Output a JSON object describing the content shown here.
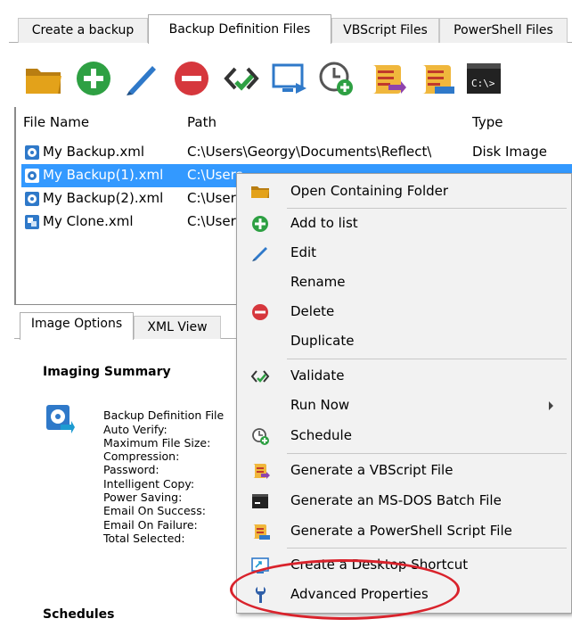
{
  "tabs": [
    {
      "label": "Create a backup",
      "active": false
    },
    {
      "label": "Backup Definition Files",
      "active": true
    },
    {
      "label": "VBScript Files",
      "active": false
    },
    {
      "label": "PowerShell Files",
      "active": false
    }
  ],
  "toolbar": {
    "buttons": [
      {
        "name": "open-folder",
        "icon": "folder-icon"
      },
      {
        "name": "add",
        "icon": "plus-circle-icon"
      },
      {
        "name": "edit",
        "icon": "pencil-icon"
      },
      {
        "name": "delete",
        "icon": "minus-circle-icon"
      },
      {
        "name": "validate",
        "icon": "validate-icon"
      },
      {
        "name": "run-now",
        "icon": "monitor-run-icon"
      },
      {
        "name": "schedule",
        "icon": "clock-add-icon"
      },
      {
        "name": "vbscript",
        "icon": "script-icon"
      },
      {
        "name": "powershell",
        "icon": "powershell-script-icon"
      },
      {
        "name": "msdos",
        "icon": "cmd-icon"
      }
    ],
    "cmd_label": "C:\\>"
  },
  "file_list": {
    "headers": {
      "name": "File Name",
      "path": "Path",
      "type": "Type"
    },
    "rows": [
      {
        "name": "My Backup.xml",
        "path": "C:\\Users\\Georgy\\Documents\\Reflect\\",
        "type": "Disk Image",
        "state": "normal"
      },
      {
        "name": "My Backup(1).xml",
        "path": "C:\\Users",
        "type": "",
        "state": "highlight"
      },
      {
        "name": "My Backup(2).xml",
        "path": "C:\\Users",
        "type": "",
        "state": "normal"
      },
      {
        "name": "My Clone.xml",
        "path": "C:\\Users",
        "type": "",
        "state": "normal"
      }
    ]
  },
  "lower_tabs": [
    {
      "label": "Image Options",
      "active": true
    },
    {
      "label": "XML View",
      "active": false
    }
  ],
  "summary": {
    "title": "Imaging Summary",
    "items": [
      "Backup Definition File",
      "Auto Verify:",
      "Maximum File Size:",
      "Compression:",
      "Password:",
      "Intelligent Copy:",
      "Power Saving:",
      "Email On Success:",
      "Email On Failure:",
      "Total Selected:"
    ]
  },
  "schedules_title": "Schedules",
  "context_menu": {
    "items": [
      {
        "label": "Open Containing Folder",
        "icon": "folder-icon"
      },
      {
        "label": "Add to list",
        "icon": "plus-circle-icon"
      },
      {
        "label": "Edit",
        "icon": "pencil-icon"
      },
      {
        "label": "Rename",
        "icon": ""
      },
      {
        "label": "Delete",
        "icon": "minus-circle-icon"
      },
      {
        "label": "Duplicate",
        "icon": ""
      },
      {
        "label": "Validate",
        "icon": "validate-icon"
      },
      {
        "label": "Run Now",
        "icon": "",
        "submenu": true
      },
      {
        "label": "Schedule",
        "icon": "clock-add-icon"
      },
      {
        "label": "Generate a VBScript File",
        "icon": "script-icon"
      },
      {
        "label": "Generate an MS-DOS Batch File",
        "icon": "cmd-icon"
      },
      {
        "label": "Generate a PowerShell Script File",
        "icon": "powershell-script-icon"
      },
      {
        "label": "Create a Desktop Shortcut",
        "icon": "shortcut-icon"
      },
      {
        "label": "Advanced Properties",
        "icon": "wrench-icon",
        "hovered": true
      }
    ]
  },
  "colors": {
    "selection_blue": "#3399ff",
    "menu_background": "#f2f2f2",
    "highlight_circle": "#d9232c",
    "add_green": "#2ea043",
    "delete_red": "#d6373d",
    "folder_orange": "#e3a21a"
  }
}
